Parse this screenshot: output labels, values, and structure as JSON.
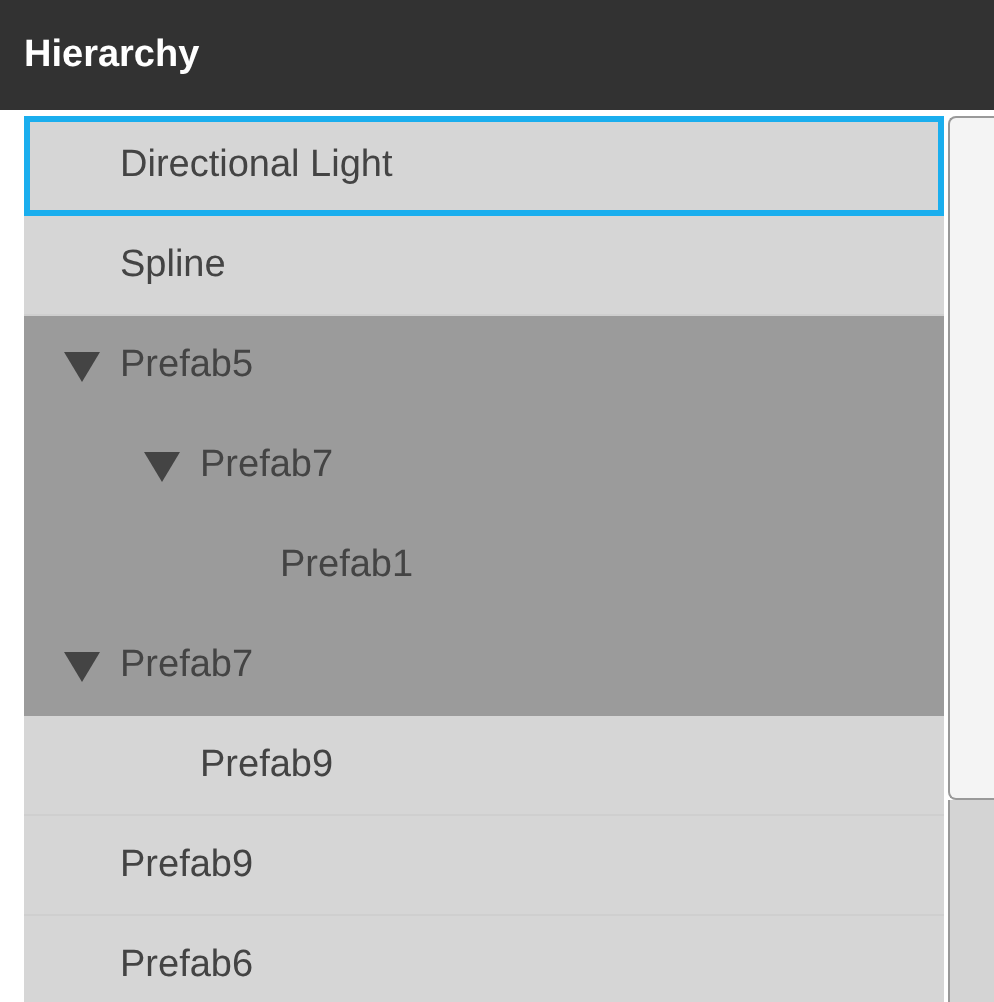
{
  "panel": {
    "title": "Hierarchy"
  },
  "items": [
    {
      "label": "Directional Light",
      "selected": false,
      "focused": true
    },
    {
      "label": "Spline",
      "selected": false,
      "focused": false
    },
    {
      "label": "Prefab5",
      "selected": true,
      "focused": false,
      "expanded": true,
      "children": [
        {
          "label": "Prefab7",
          "selected": true,
          "focused": false,
          "expanded": true,
          "children": [
            {
              "label": "Prefab1",
              "selected": true,
              "focused": false
            }
          ]
        }
      ]
    },
    {
      "label": "Prefab7",
      "selected": true,
      "focused": false,
      "expanded": true,
      "children": [
        {
          "label": "Prefab9",
          "selected": false,
          "focused": false
        }
      ]
    },
    {
      "label": "Prefab9",
      "selected": false,
      "focused": false
    },
    {
      "label": "Prefab6",
      "selected": false,
      "focused": false
    }
  ]
}
